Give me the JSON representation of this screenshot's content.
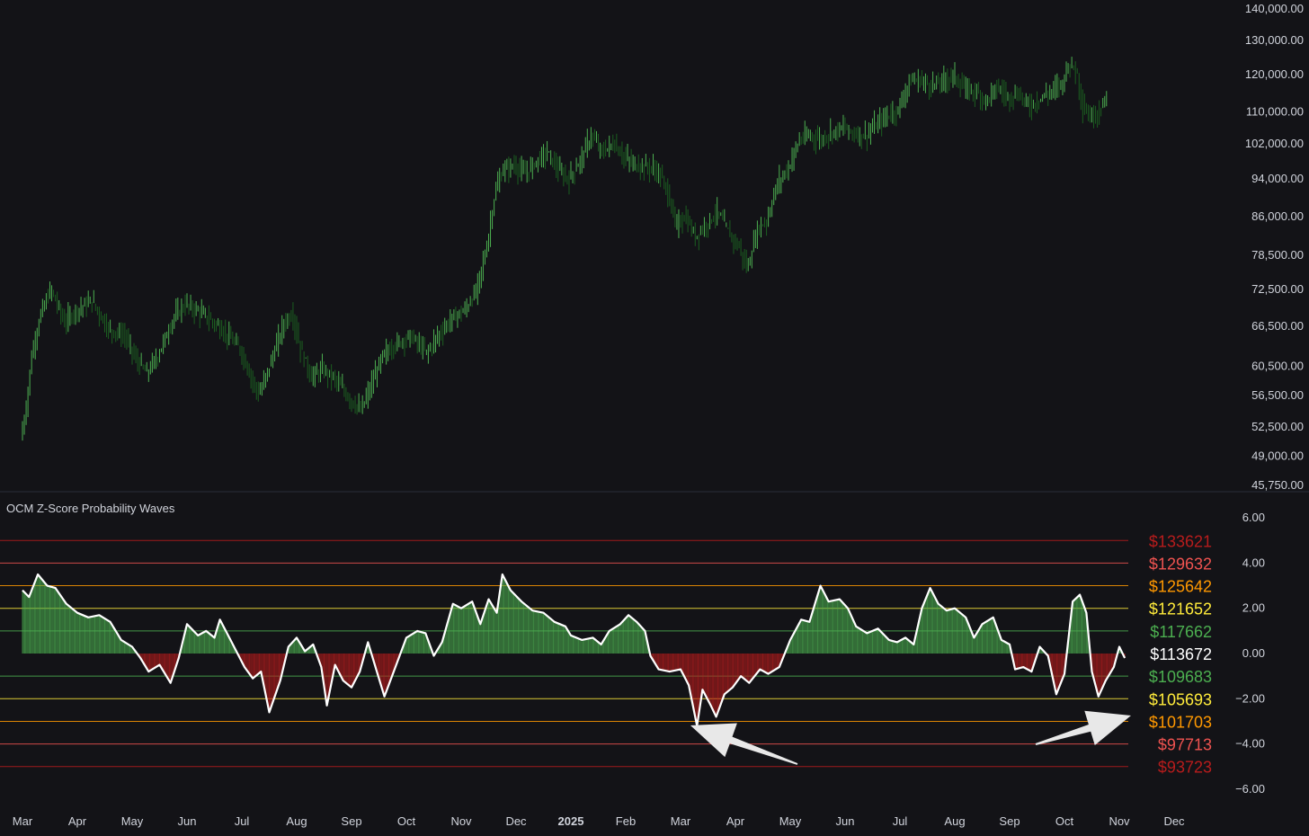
{
  "colors": {
    "background": "#131317",
    "candle_up": "#4caf50",
    "candle_down": "#1b5e20",
    "hist_pos": "#4caf50",
    "hist_neg": "#b71c1c",
    "zline": "#ffffff",
    "axis_text": "#d1d4dc",
    "divider": "#2a2e39",
    "arrow": "#e8e8e8"
  },
  "chart_data": [
    {
      "type": "candlestick",
      "scale": "log",
      "ylim": [
        45750,
        140000
      ],
      "y_ticks": [
        "140,000.00",
        "130,000.00",
        "120,000.00",
        "110,000.00",
        "102,000.00",
        "94,000.00",
        "86,000.00",
        "78,500.00",
        "72,500.00",
        "66,500.00",
        "60,500.00",
        "56,500.00",
        "52,500.00",
        "49,000.00",
        "45,750.00"
      ],
      "y_tick_values": [
        140000,
        130000,
        120000,
        110000,
        102000,
        94000,
        86000,
        78500,
        72500,
        66500,
        60500,
        56500,
        52500,
        49000,
        45750
      ],
      "x_labels": [
        "Mar",
        "Apr",
        "May",
        "Jun",
        "Jul",
        "Aug",
        "Sep",
        "Oct",
        "Nov",
        "Dec",
        "2025",
        "Feb",
        "Mar",
        "Apr",
        "May",
        "Jun",
        "Jul",
        "Aug",
        "Sep",
        "Oct",
        "Nov",
        "Dec"
      ],
      "x_label_bold_index": 10,
      "price_path": [
        [
          0,
          51000
        ],
        [
          0.1,
          55000
        ],
        [
          0.2,
          62000
        ],
        [
          0.35,
          68000
        ],
        [
          0.55,
          72500
        ],
        [
          0.8,
          67000
        ],
        [
          1.0,
          69000
        ],
        [
          1.3,
          70500
        ],
        [
          1.6,
          66000
        ],
        [
          1.9,
          65000
        ],
        [
          2.1,
          61500
        ],
        [
          2.3,
          59500
        ],
        [
          2.5,
          62000
        ],
        [
          2.8,
          68000
        ],
        [
          3.0,
          70000
        ],
        [
          3.3,
          68500
        ],
        [
          3.6,
          66500
        ],
        [
          4.0,
          63000
        ],
        [
          4.2,
          59000
        ],
        [
          4.35,
          56500
        ],
        [
          4.6,
          62000
        ],
        [
          4.8,
          67000
        ],
        [
          4.95,
          68500
        ],
        [
          5.1,
          63000
        ],
        [
          5.3,
          59000
        ],
        [
          5.5,
          60000
        ],
        [
          5.7,
          59000
        ],
        [
          6.0,
          56000
        ],
        [
          6.2,
          54500
        ],
        [
          6.4,
          58000
        ],
        [
          6.6,
          62000
        ],
        [
          6.8,
          63500
        ],
        [
          7.1,
          65000
        ],
        [
          7.4,
          62500
        ],
        [
          7.6,
          65000
        ],
        [
          7.9,
          68000
        ],
        [
          8.1,
          69000
        ],
        [
          8.3,
          72000
        ],
        [
          8.5,
          80000
        ],
        [
          8.65,
          91000
        ],
        [
          8.8,
          96000
        ],
        [
          9.0,
          97000
        ],
        [
          9.2,
          95000
        ],
        [
          9.4,
          98000
        ],
        [
          9.6,
          100000
        ],
        [
          9.85,
          95000
        ],
        [
          10.0,
          94000
        ],
        [
          10.2,
          98000
        ],
        [
          10.4,
          104000
        ],
        [
          10.6,
          100000
        ],
        [
          10.8,
          102000
        ],
        [
          11.0,
          99000
        ],
        [
          11.2,
          97000
        ],
        [
          11.5,
          96500
        ],
        [
          11.65,
          95000
        ],
        [
          11.8,
          91000
        ],
        [
          11.95,
          84000
        ],
        [
          12.1,
          86000
        ],
        [
          12.3,
          82000
        ],
        [
          12.5,
          84500
        ],
        [
          12.7,
          87000
        ],
        [
          12.9,
          83000
        ],
        [
          13.1,
          80000
        ],
        [
          13.25,
          76000
        ],
        [
          13.45,
          84000
        ],
        [
          13.6,
          85000
        ],
        [
          13.8,
          93000
        ],
        [
          14.0,
          96500
        ],
        [
          14.2,
          103000
        ],
        [
          14.4,
          104000
        ],
        [
          14.6,
          103000
        ],
        [
          14.8,
          105000
        ],
        [
          15.0,
          106000
        ],
        [
          15.2,
          104500
        ],
        [
          15.4,
          104000
        ],
        [
          15.6,
          106500
        ],
        [
          15.8,
          109000
        ],
        [
          16.0,
          110500
        ],
        [
          16.2,
          118000
        ],
        [
          16.4,
          118500
        ],
        [
          16.6,
          117000
        ],
        [
          16.8,
          118000
        ],
        [
          17.0,
          120000
        ],
        [
          17.2,
          116000
        ],
        [
          17.4,
          115500
        ],
        [
          17.6,
          113000
        ],
        [
          17.8,
          116500
        ],
        [
          18.0,
          114000
        ],
        [
          18.2,
          114500
        ],
        [
          18.4,
          111500
        ],
        [
          18.6,
          113500
        ],
        [
          18.8,
          115500
        ],
        [
          19.0,
          118000
        ],
        [
          19.1,
          123000
        ],
        [
          19.25,
          121500
        ],
        [
          19.35,
          112000
        ],
        [
          19.5,
          108500
        ],
        [
          19.65,
          110000
        ],
        [
          19.8,
          113500
        ]
      ]
    },
    {
      "type": "bar+line",
      "title": "OCM Z-Score Probability Waves",
      "ylim": [
        -6.8,
        6.8
      ],
      "y_ticks": [
        "6.00",
        "4.00",
        "2.00",
        "0.00",
        "−2.00",
        "−4.00",
        "−6.00"
      ],
      "y_tick_values": [
        6,
        4,
        2,
        0,
        -2,
        -4,
        -6
      ],
      "bands": [
        {
          "z": 5,
          "label": "$133621",
          "color": "#b71c1c"
        },
        {
          "z": 4,
          "label": "$129632",
          "color": "#ef5350"
        },
        {
          "z": 3,
          "label": "$125642",
          "color": "#ff9800"
        },
        {
          "z": 2,
          "label": "$121652",
          "color": "#ffeb3b"
        },
        {
          "z": 1,
          "label": "$117662",
          "color": "#4caf50"
        },
        {
          "z": 0,
          "label": "$113672",
          "color": "#ffffff"
        },
        {
          "z": -1,
          "label": "$109683",
          "color": "#4caf50"
        },
        {
          "z": -2,
          "label": "$105693",
          "color": "#ffeb3b"
        },
        {
          "z": -3,
          "label": "$101703",
          "color": "#ff9800"
        },
        {
          "z": -4,
          "label": "$97713",
          "color": "#ef5350"
        },
        {
          "z": -5,
          "label": "$93723",
          "color": "#b71c1c"
        }
      ],
      "z_path": [
        [
          0,
          2.8
        ],
        [
          0.12,
          2.5
        ],
        [
          0.28,
          3.5
        ],
        [
          0.45,
          3.0
        ],
        [
          0.6,
          2.9
        ],
        [
          0.8,
          2.2
        ],
        [
          1.0,
          1.8
        ],
        [
          1.2,
          1.6
        ],
        [
          1.4,
          1.7
        ],
        [
          1.6,
          1.4
        ],
        [
          1.8,
          0.6
        ],
        [
          2.0,
          0.3
        ],
        [
          2.15,
          -0.2
        ],
        [
          2.3,
          -0.8
        ],
        [
          2.5,
          -0.5
        ],
        [
          2.7,
          -1.3
        ],
        [
          2.85,
          -0.2
        ],
        [
          3.0,
          1.3
        ],
        [
          3.2,
          0.8
        ],
        [
          3.35,
          1.0
        ],
        [
          3.5,
          0.7
        ],
        [
          3.6,
          1.5
        ],
        [
          3.75,
          0.8
        ],
        [
          3.9,
          0.1
        ],
        [
          4.05,
          -0.6
        ],
        [
          4.2,
          -1.1
        ],
        [
          4.35,
          -0.8
        ],
        [
          4.5,
          -2.6
        ],
        [
          4.7,
          -1.2
        ],
        [
          4.85,
          0.3
        ],
        [
          5.0,
          0.7
        ],
        [
          5.15,
          0.1
        ],
        [
          5.3,
          0.4
        ],
        [
          5.45,
          -0.6
        ],
        [
          5.55,
          -2.3
        ],
        [
          5.7,
          -0.5
        ],
        [
          5.85,
          -1.2
        ],
        [
          6.0,
          -1.5
        ],
        [
          6.15,
          -0.8
        ],
        [
          6.3,
          0.5
        ],
        [
          6.45,
          -0.7
        ],
        [
          6.6,
          -1.9
        ],
        [
          6.8,
          -0.6
        ],
        [
          7.0,
          0.7
        ],
        [
          7.2,
          1.0
        ],
        [
          7.35,
          0.9
        ],
        [
          7.5,
          -0.1
        ],
        [
          7.65,
          0.5
        ],
        [
          7.85,
          2.2
        ],
        [
          8.0,
          2.0
        ],
        [
          8.2,
          2.3
        ],
        [
          8.35,
          1.3
        ],
        [
          8.5,
          2.4
        ],
        [
          8.65,
          1.8
        ],
        [
          8.75,
          3.5
        ],
        [
          8.9,
          2.8
        ],
        [
          9.1,
          2.3
        ],
        [
          9.3,
          1.9
        ],
        [
          9.5,
          1.8
        ],
        [
          9.7,
          1.4
        ],
        [
          9.9,
          1.2
        ],
        [
          10.0,
          0.8
        ],
        [
          10.2,
          0.6
        ],
        [
          10.4,
          0.7
        ],
        [
          10.55,
          0.4
        ],
        [
          10.7,
          1.0
        ],
        [
          10.9,
          1.3
        ],
        [
          11.05,
          1.7
        ],
        [
          11.2,
          1.4
        ],
        [
          11.35,
          1.0
        ],
        [
          11.45,
          -0.1
        ],
        [
          11.6,
          -0.7
        ],
        [
          11.8,
          -0.8
        ],
        [
          12.0,
          -0.7
        ],
        [
          12.15,
          -1.4
        ],
        [
          12.3,
          -3.2
        ],
        [
          12.4,
          -1.6
        ],
        [
          12.55,
          -2.3
        ],
        [
          12.65,
          -2.8
        ],
        [
          12.8,
          -1.8
        ],
        [
          12.95,
          -1.5
        ],
        [
          13.1,
          -1.0
        ],
        [
          13.25,
          -1.3
        ],
        [
          13.45,
          -0.7
        ],
        [
          13.6,
          -0.9
        ],
        [
          13.8,
          -0.6
        ],
        [
          14.0,
          0.6
        ],
        [
          14.2,
          1.5
        ],
        [
          14.35,
          1.4
        ],
        [
          14.55,
          3.0
        ],
        [
          14.7,
          2.3
        ],
        [
          14.9,
          2.4
        ],
        [
          15.05,
          2.0
        ],
        [
          15.2,
          1.2
        ],
        [
          15.4,
          0.9
        ],
        [
          15.6,
          1.1
        ],
        [
          15.8,
          0.6
        ],
        [
          15.95,
          0.5
        ],
        [
          16.1,
          0.7
        ],
        [
          16.25,
          0.4
        ],
        [
          16.4,
          2.0
        ],
        [
          16.55,
          2.9
        ],
        [
          16.7,
          2.2
        ],
        [
          16.85,
          1.9
        ],
        [
          17.0,
          2.0
        ],
        [
          17.2,
          1.6
        ],
        [
          17.35,
          0.7
        ],
        [
          17.5,
          1.3
        ],
        [
          17.7,
          1.6
        ],
        [
          17.85,
          0.6
        ],
        [
          18.0,
          0.4
        ],
        [
          18.1,
          -0.7
        ],
        [
          18.25,
          -0.6
        ],
        [
          18.4,
          -0.8
        ],
        [
          18.55,
          0.3
        ],
        [
          18.7,
          -0.1
        ],
        [
          18.85,
          -1.8
        ],
        [
          19.0,
          -0.9
        ],
        [
          19.15,
          2.3
        ],
        [
          19.28,
          2.6
        ],
        [
          19.4,
          1.8
        ],
        [
          19.5,
          -0.8
        ],
        [
          19.62,
          -1.9
        ],
        [
          19.75,
          -1.2
        ],
        [
          19.9,
          -0.6
        ],
        [
          20.0,
          0.3
        ],
        [
          20.1,
          -0.2
        ]
      ]
    }
  ]
}
